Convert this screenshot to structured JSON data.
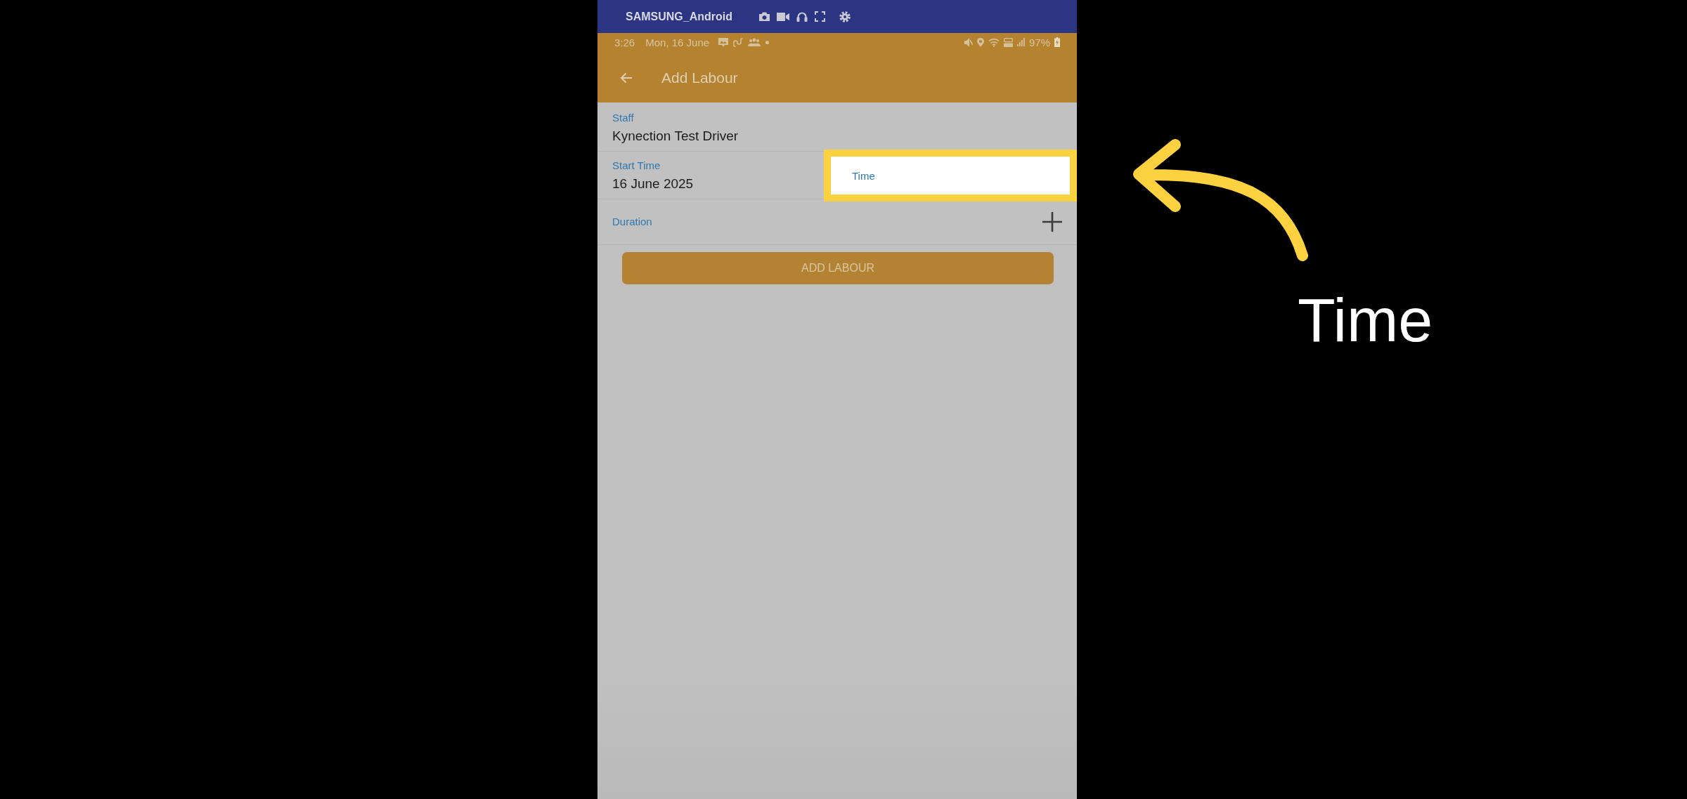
{
  "mirroring_bar": {
    "device_name": "SAMSUNG_Android"
  },
  "status_bar": {
    "time": "3:26",
    "date": "Mon, 16 June",
    "battery": "97%"
  },
  "app_bar": {
    "title": "Add Labour"
  },
  "form": {
    "fields": [
      {
        "kind": "text",
        "label": "Staff",
        "value": "Kynection Test Driver"
      },
      {
        "kind": "datetime",
        "label": "Start Time",
        "value": "16 June 2025",
        "time_field": {
          "placeholder": "Time",
          "highlighted": true
        }
      },
      {
        "kind": "add",
        "label": "Duration"
      }
    ]
  },
  "submit_button": {
    "label": "ADD LABOUR"
  },
  "annotation": {
    "label": "Time"
  }
}
